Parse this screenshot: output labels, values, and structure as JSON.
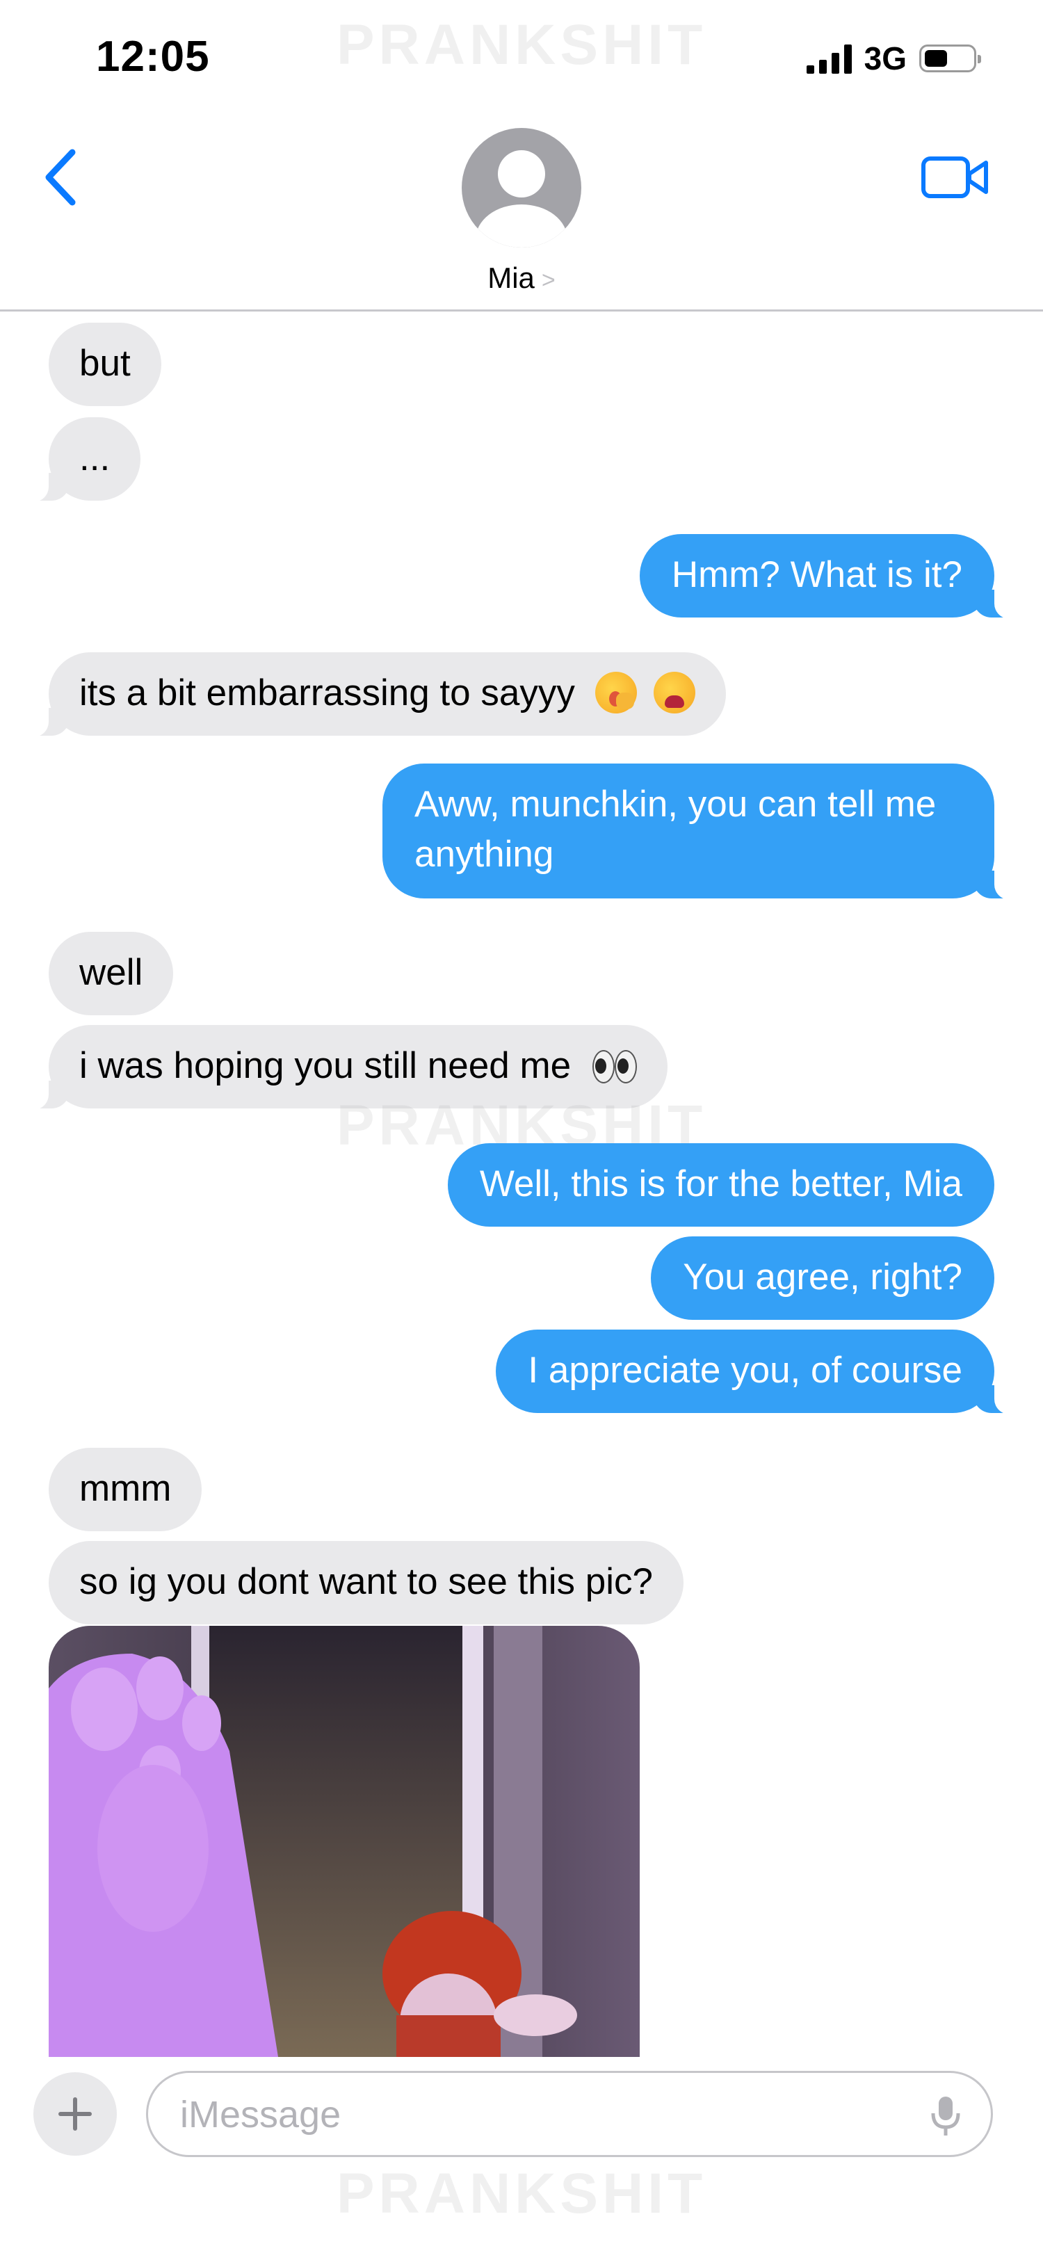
{
  "status_bar": {
    "time": "12:05",
    "network": "3G"
  },
  "watermark": "PRANKSHIT",
  "header": {
    "contact_name": "Mia"
  },
  "messages": [
    {
      "from": "contact",
      "text": "but"
    },
    {
      "from": "contact",
      "text": "..."
    },
    {
      "from": "me",
      "text": "Hmm? What is it?"
    },
    {
      "from": "contact",
      "text": "its a bit embarrassing to sayyy",
      "emojis": [
        "face-with-hand-over-mouth-emoji",
        "weary-face-emoji"
      ]
    },
    {
      "from": "me",
      "text": "Aww, munchkin, you can tell me anything"
    },
    {
      "from": "contact",
      "text": "well"
    },
    {
      "from": "contact",
      "text": "i was hoping you still need me",
      "emojis": [
        "eyes-emoji"
      ]
    },
    {
      "from": "me",
      "text": "Well, this is for the better, Mia"
    },
    {
      "from": "me",
      "text": "You agree, right?"
    },
    {
      "from": "me",
      "text": "I appreciate you, of course"
    },
    {
      "from": "contact",
      "text": "mmm"
    },
    {
      "from": "contact",
      "text": "so ig you dont want to see this pic?"
    },
    {
      "from": "contact",
      "type": "image"
    }
  ],
  "composer": {
    "placeholder": "iMessage"
  },
  "colors": {
    "accent": "#0a7aff",
    "outgoing_bubble": "#34a0f6",
    "incoming_bubble": "#e9e9eb"
  }
}
